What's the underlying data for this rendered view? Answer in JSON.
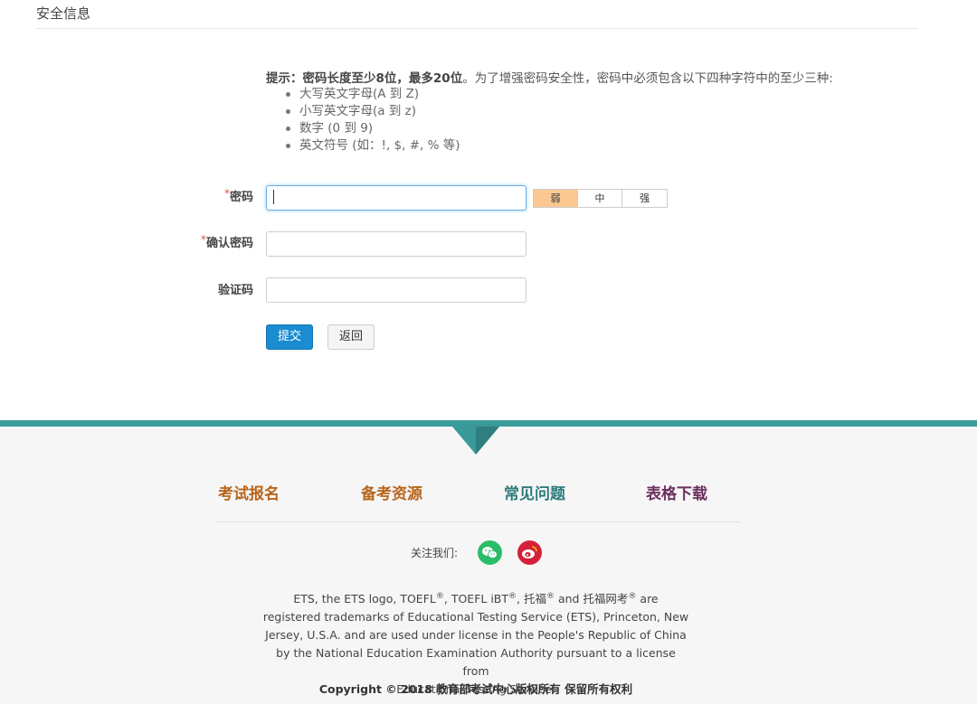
{
  "section": {
    "title": "安全信息"
  },
  "hint": {
    "prefix": "提示：密码长度",
    "min": "至少8位",
    "sep": "，",
    "max": "最多20位",
    "suffix": "。为了增强密码安全性，密码中必须包含以下四种字符中的至少三种:",
    "items": [
      "大写英文字母(A 到 Z)",
      "小写英文字母(a 到 z)",
      "数字 (0 到 9)",
      "英文符号 (如：!, $, #, % 等)"
    ]
  },
  "form": {
    "required_mark": "*",
    "password_label": "密码",
    "confirm_label": "确认密码",
    "captcha_label": "验证码",
    "password_value": "",
    "confirm_value": "",
    "captcha_value": "",
    "strength": {
      "weak": "弱",
      "medium": "中",
      "strong": "强",
      "level": "weak",
      "active_color": "#fbc892"
    },
    "submit_label": "提交",
    "back_label": "返回"
  },
  "footer": {
    "nav": [
      {
        "label": "考试报名",
        "color": "#b7651c"
      },
      {
        "label": "备考资源",
        "color": "#b7651c"
      },
      {
        "label": "常见问题",
        "color": "#2e7b7c"
      },
      {
        "label": "表格下载",
        "color": "#6b2f5e"
      }
    ],
    "follow_label": "关注我们:",
    "social": [
      {
        "icon": "wechat-icon",
        "color": "#2bbc6a"
      },
      {
        "icon": "weibo-icon",
        "color": "#d5203a"
      }
    ],
    "legal": {
      "l1a": "ETS, the ETS logo, TOEFL",
      "reg": "®",
      "l1b": ", TOEFL iBT",
      "l1c": ", 托福",
      "l1d": " and 托福网考",
      "l1e": " are",
      "l2": "registered trademarks of Educational Testing Service (ETS), Princeton, New",
      "l3": "Jersey, U.S.A. and are used under license in the People's Republic of China",
      "l4": "by the National Education Examination Authority pursuant to a license from",
      "l5": "Educational Testing Service."
    },
    "copyright": "Copyright © 2018 教育部考试中心版权所有 保留所有权利"
  },
  "colors": {
    "accent": "#3a9a9a",
    "primary_button": "#1a8ccf"
  }
}
